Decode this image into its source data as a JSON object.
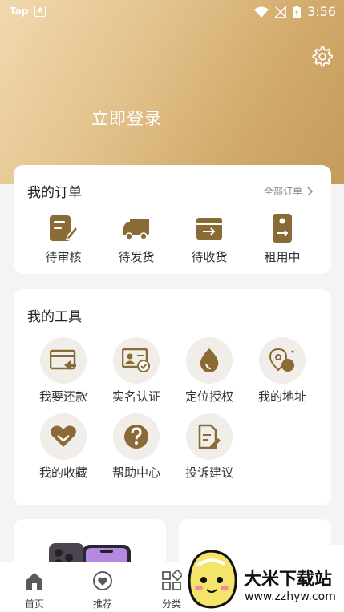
{
  "status": {
    "left_label": "Tap",
    "app_badge": "A",
    "time": "3:56"
  },
  "header": {
    "login_text": "立即登录"
  },
  "orders": {
    "title": "我的订单",
    "all_label": "全部订单",
    "items": [
      {
        "label": "待审核",
        "icon": "clipboard-edit-icon"
      },
      {
        "label": "待发货",
        "icon": "truck-icon"
      },
      {
        "label": "待收货",
        "icon": "box-arrow-icon"
      },
      {
        "label": "租用中",
        "icon": "phone-transfer-icon"
      }
    ]
  },
  "tools": {
    "title": "我的工具",
    "items": [
      {
        "label": "我要还款",
        "icon": "return-card-icon"
      },
      {
        "label": "实名认证",
        "icon": "id-card-check-icon"
      },
      {
        "label": "定位授权",
        "icon": "location-drop-icon"
      },
      {
        "label": "我的地址",
        "icon": "map-pin-icon"
      },
      {
        "label": "我的收藏",
        "icon": "heart-icon"
      },
      {
        "label": "帮助中心",
        "icon": "question-icon"
      },
      {
        "label": "投诉建议",
        "icon": "document-edit-icon"
      }
    ]
  },
  "tabbar": {
    "items": [
      {
        "label": "首页",
        "icon": "home-icon"
      },
      {
        "label": "推荐",
        "icon": "heart-circle-icon"
      },
      {
        "label": "分类",
        "icon": "grid-icon"
      }
    ]
  },
  "watermark": {
    "title": "大米下载站",
    "url": "www.zzhyw.com"
  },
  "colors": {
    "accent": "#8a6a35",
    "header_gradient_start": "#f1d9ae",
    "header_gradient_end": "#c39b5a"
  }
}
